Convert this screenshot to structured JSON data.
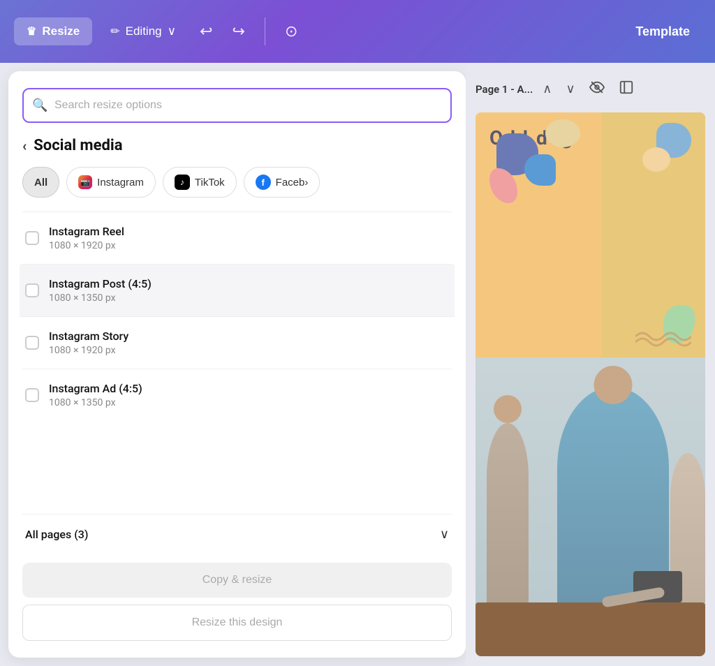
{
  "header": {
    "resize_label": "Resize",
    "editing_label": "Editing",
    "template_label": "Template",
    "crown_icon": "♛",
    "pencil_icon": "✏",
    "chevron_down_icon": "∨",
    "undo_icon": "↩",
    "redo_icon": "↪",
    "cloud_icon": "⊙"
  },
  "panel": {
    "search_placeholder": "Search resize options",
    "back_icon": "‹",
    "section_title": "Social media",
    "filters": [
      {
        "id": "all",
        "label": "All",
        "active": true
      },
      {
        "id": "instagram",
        "label": "Instagram",
        "icon": "insta"
      },
      {
        "id": "tiktok",
        "label": "TikTok",
        "icon": "tiktok"
      },
      {
        "id": "facebook",
        "label": "Faceb›",
        "icon": "fb"
      }
    ],
    "items": [
      {
        "name": "Instagram Reel",
        "dims": "1080 × 1920 px",
        "highlighted": false
      },
      {
        "name": "Instagram Post (4:5)",
        "dims": "1080 × 1350 px",
        "highlighted": true
      },
      {
        "name": "Instagram Story",
        "dims": "1080 × 1920 px",
        "highlighted": false
      },
      {
        "name": "Instagram Ad (4:5)",
        "dims": "1080 × 1350 px",
        "highlighted": false
      }
    ],
    "all_pages_label": "All pages (3)",
    "chevron_down": "∨",
    "copy_resize_label": "Copy & resize",
    "resize_design_label": "Resize this design"
  },
  "canvas": {
    "page_label": "Page 1 - A...",
    "up_icon": "∧",
    "down_icon": "∨",
    "eye_icon": "⊘",
    "options_icon": "▭"
  }
}
